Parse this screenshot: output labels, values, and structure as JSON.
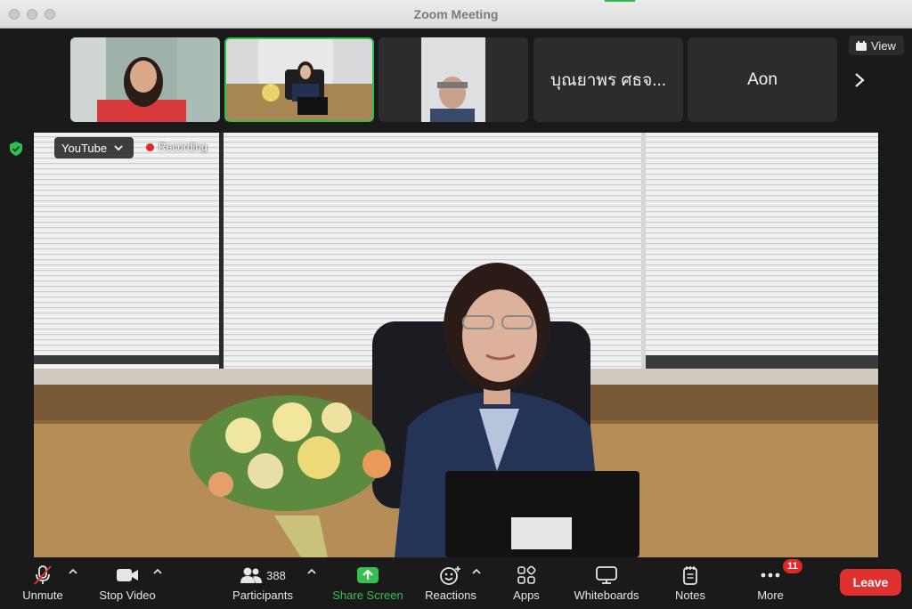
{
  "window": {
    "title": "Zoom Meeting"
  },
  "strip": {
    "tiles": [
      {
        "kind": "video",
        "label": "participant-video-1"
      },
      {
        "kind": "video",
        "label": "participant-video-2-active"
      },
      {
        "kind": "video",
        "label": "participant-video-3"
      },
      {
        "kind": "name",
        "name": "บุณยาพร ศธจ..."
      },
      {
        "kind": "name",
        "name": "Aon"
      }
    ],
    "view_label": "View"
  },
  "main": {
    "youtube_label": "YouTube",
    "recording_label": "Recording"
  },
  "toolbar": {
    "unmute": "Unmute",
    "stop_video": "Stop Video",
    "participants": "Participants",
    "participants_count": "388",
    "share_screen": "Share Screen",
    "reactions": "Reactions",
    "apps": "Apps",
    "whiteboards": "Whiteboards",
    "notes": "Notes",
    "more": "More",
    "more_badge": "11",
    "leave": "Leave"
  },
  "colors": {
    "accent_green": "#2fbf4e",
    "leave_red": "#e0302f",
    "recording_red": "#e22727"
  },
  "icons": [
    "microphone-muted-icon",
    "video-camera-icon",
    "participants-icon",
    "share-screen-icon",
    "reactions-icon",
    "apps-icon",
    "whiteboard-icon",
    "notes-icon",
    "more-icon",
    "shield-icon",
    "chevron-down-icon",
    "chevron-right-icon",
    "view-grid-icon"
  ]
}
